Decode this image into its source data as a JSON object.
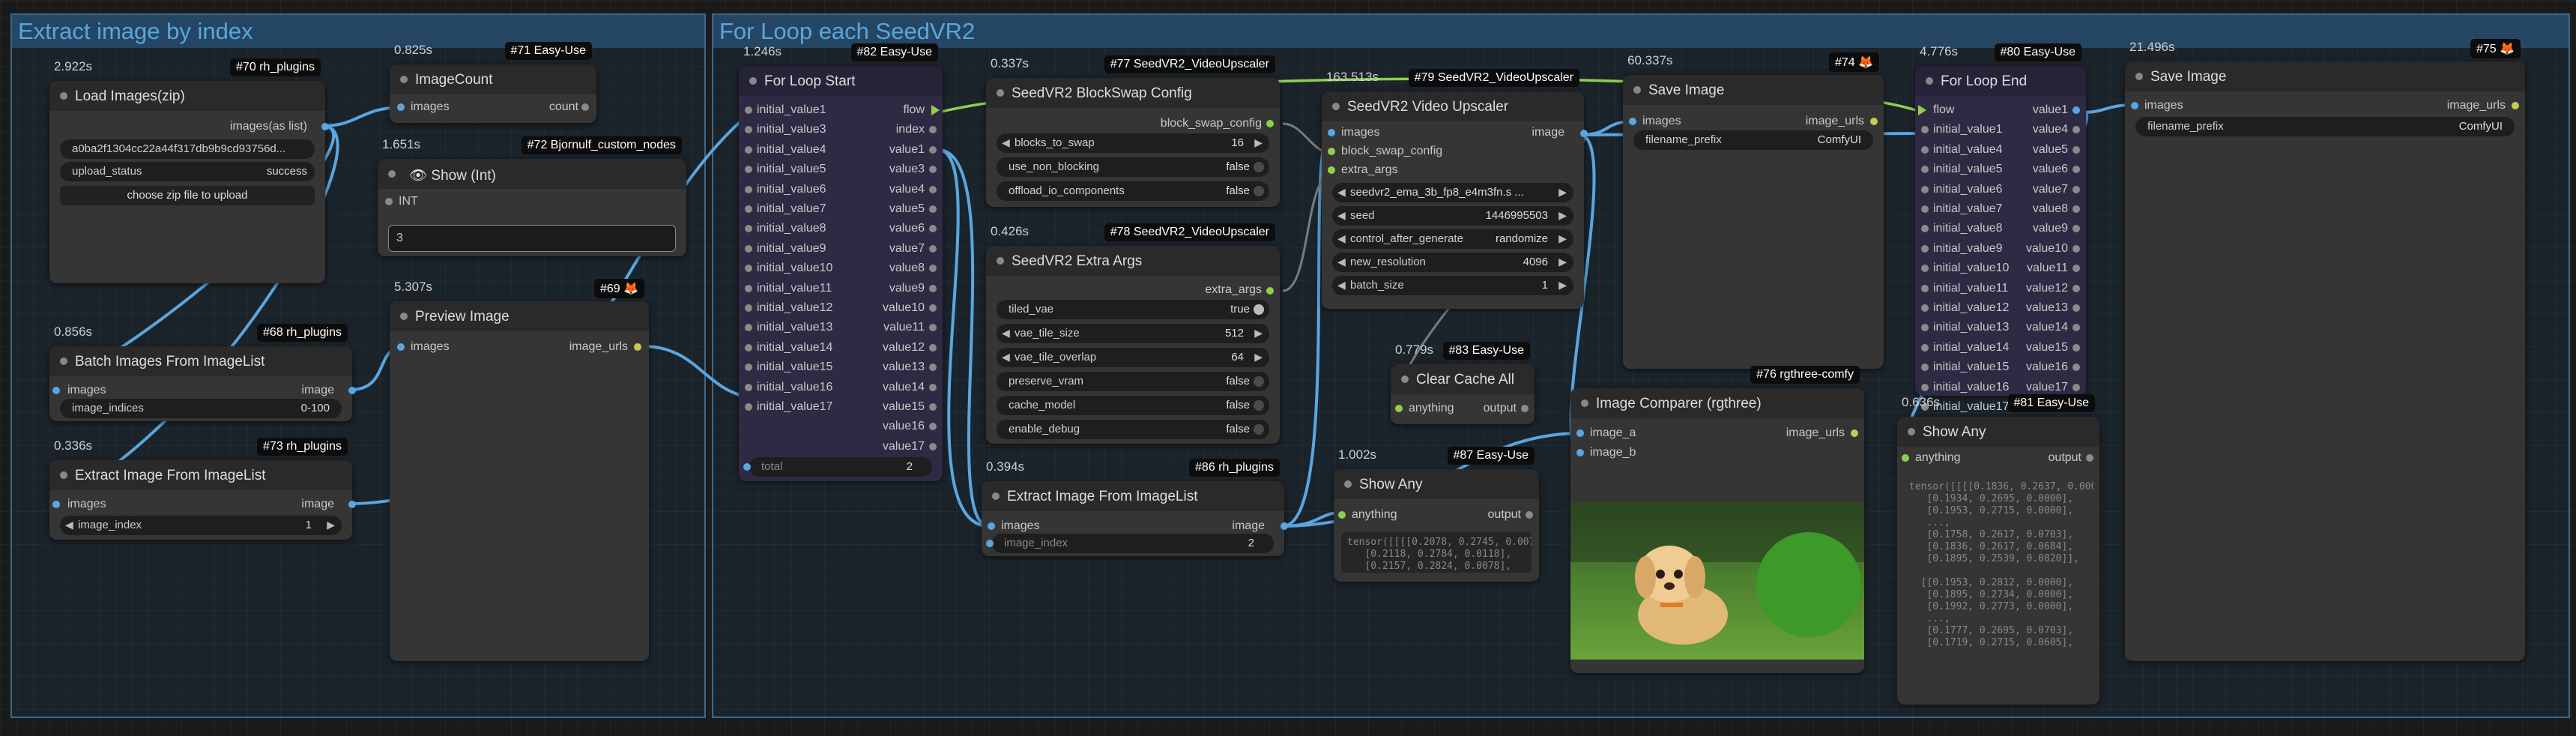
{
  "groups": {
    "left": "Extract image by index",
    "right": "For Loop each SeedVR2"
  },
  "nodes": {
    "n70": {
      "badge": "#70 rh_plugins",
      "time": "2.922s",
      "title": "Load Images(zip)",
      "out": "images(as list)",
      "file": "a0ba2f1304cc22a44f317db9b9cd93756d...",
      "status_label": "upload_status",
      "status_value": "success",
      "button": "choose zip file to upload"
    },
    "n71": {
      "badge": "#71 Easy-Use",
      "time": "0.825s",
      "title": "ImageCount",
      "in": "images",
      "out": "count"
    },
    "n72": {
      "badge": "#72 Bjornulf_custom_nodes",
      "time": "1.651s",
      "title": "Show (Int)",
      "in": "INT",
      "value": "3"
    },
    "n68": {
      "badge": "#68 rh_plugins",
      "time": "0.856s",
      "title": "Batch Images From ImageList",
      "in": "images",
      "out": "image",
      "w_label": "image_indices",
      "w_value": "0-100"
    },
    "n73": {
      "badge": "#73 rh_plugins",
      "time": "0.336s",
      "title": "Extract Image From ImageList",
      "in": "images",
      "out": "image",
      "w_label": "image_index",
      "w_value": "1"
    },
    "n69": {
      "badge": "#69 🦊",
      "time": "5.307s",
      "title": "Preview Image",
      "in": "images",
      "out": "image_urls"
    },
    "n82": {
      "badge": "#82 Easy-Use",
      "time": "1.246s",
      "title": "For Loop Start",
      "inputs": [
        "initial_value1",
        "initial_value3",
        "initial_value4",
        "initial_value5",
        "initial_value6",
        "initial_value7",
        "initial_value8",
        "initial_value9",
        "initial_value10",
        "initial_value11",
        "initial_value12",
        "initial_value13",
        "initial_value14",
        "initial_value15",
        "initial_value16",
        "initial_value17"
      ],
      "outputs": [
        "flow",
        "index",
        "value1",
        "value3",
        "value4",
        "value5",
        "value6",
        "value7",
        "value8",
        "value9",
        "value10",
        "value11",
        "value12",
        "value13",
        "value14",
        "value15",
        "value16",
        "value17"
      ],
      "total_label": "total",
      "total_value": "2"
    },
    "n77": {
      "badge": "#77 SeedVR2_VideoUpscaler",
      "time": "0.337s",
      "title": "SeedVR2 BlockSwap Config",
      "out": "block_swap_config",
      "widgets": [
        [
          "blocks_to_swap",
          "16",
          "num"
        ],
        [
          "use_non_blocking",
          "false",
          "tog"
        ],
        [
          "offload_io_components",
          "false",
          "tog"
        ]
      ]
    },
    "n78": {
      "badge": "#78 SeedVR2_VideoUpscaler",
      "time": "0.426s",
      "title": "SeedVR2 Extra Args",
      "out": "extra_args",
      "widgets": [
        [
          "tiled_vae",
          "true",
          "togon"
        ],
        [
          "vae_tile_size",
          "512",
          "num"
        ],
        [
          "vae_tile_overlap",
          "64",
          "num"
        ],
        [
          "preserve_vram",
          "false",
          "tog"
        ],
        [
          "cache_model",
          "false",
          "tog"
        ],
        [
          "enable_debug",
          "false",
          "tog"
        ]
      ]
    },
    "n86": {
      "badge": "#86 rh_plugins",
      "time": "0.394s",
      "title": "Extract Image From ImageList",
      "in": "images",
      "out": "image",
      "w_label": "image_index",
      "w_value": "2"
    },
    "n79": {
      "badge": "#79 SeedVR2_VideoUpscaler",
      "time": "163.513s",
      "title": "SeedVR2 Video Upscaler",
      "inputs": [
        "images",
        "block_swap_config",
        "extra_args"
      ],
      "out": "image",
      "widgets": [
        [
          "",
          "seedvr2_ema_3b_fp8_e4m3fn.s ...",
          "combo"
        ],
        [
          "seed",
          "1446995503",
          "num"
        ],
        [
          "control_after_generate",
          "randomize",
          "combo"
        ],
        [
          "new_resolution",
          "4096",
          "num"
        ],
        [
          "batch_size",
          "1",
          "num"
        ]
      ]
    },
    "n83": {
      "badge": "#83 Easy-Use",
      "time": "0.779s",
      "title": "Clear Cache All",
      "in": "anything",
      "out": "output"
    },
    "n87": {
      "badge": "#87 Easy-Use",
      "time": "1.002s",
      "title": "Show Any",
      "in": "anything",
      "out": "output",
      "text": "tensor([[[[0.2078, 0.2745, 0.0078],\n   [0.2118, 0.2784, 0.0118],\n   [0.2157, 0.2824, 0.0078],"
    },
    "n74": {
      "badge": "#74 🦊",
      "time": "60.337s",
      "title": "Save Image",
      "in": "images",
      "out": "image_urls",
      "w_label": "filename_prefix",
      "w_value": "ComfyUI"
    },
    "n76": {
      "badge": "#76 rgthree-comfy",
      "title": "Image Comparer (rgthree)",
      "in_a": "image_a",
      "in_b": "image_b",
      "out": "image_urls"
    },
    "n80": {
      "badge": "#80 Easy-Use",
      "time": "4.776s",
      "title": "For Loop End",
      "inputs": [
        "flow",
        "initial_value1",
        "initial_value4",
        "initial_value5",
        "initial_value6",
        "initial_value7",
        "initial_value8",
        "initial_value9",
        "initial_value10",
        "initial_value11",
        "initial_value12",
        "initial_value13",
        "initial_value14",
        "initial_value15",
        "initial_value16",
        "initial_value17"
      ],
      "outputs": [
        "value1",
        "value4",
        "value5",
        "value6",
        "value7",
        "value8",
        "value9",
        "value10",
        "value11",
        "value12",
        "value13",
        "value14",
        "value15",
        "value16",
        "value17"
      ]
    },
    "n81": {
      "badge": "#81 Easy-Use",
      "time": "0.636s",
      "title": "Show Any",
      "in": "anything",
      "out": "output",
      "text": "tensor([[[[0.1836, 0.2637, 0.0000],\n   [0.1934, 0.2695, 0.0000],\n   [0.1953, 0.2715, 0.0000],\n   ...,\n   [0.1758, 0.2617, 0.0703],\n   [0.1836, 0.2617, 0.0684],\n   [0.1895, 0.2539, 0.0820]],\n\n  [[0.1953, 0.2812, 0.0000],\n   [0.1895, 0.2734, 0.0000],\n   [0.1992, 0.2773, 0.0000],\n   ...,\n   [0.1777, 0.2695, 0.0703],\n   [0.1719, 0.2715, 0.0605],"
    },
    "n75": {
      "badge": "#75 🦊",
      "time": "21.496s",
      "title": "Save Image",
      "in": "images",
      "out": "image_urls",
      "w_label": "filename_prefix",
      "w_value": "ComfyUI"
    }
  },
  "colors": {
    "image_link": "#5aa6e0",
    "flow_link": "#8ed04e",
    "group_border": "#3a6a8f",
    "group_title": "#5aa6dc"
  }
}
